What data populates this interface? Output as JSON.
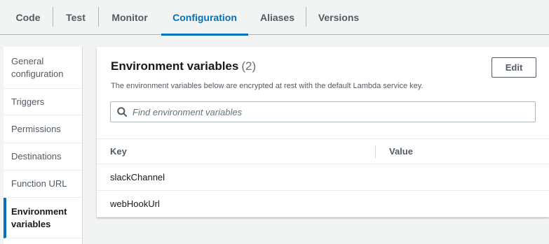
{
  "tabs": [
    {
      "label": "Code"
    },
    {
      "label": "Test"
    },
    {
      "label": "Monitor"
    },
    {
      "label": "Configuration",
      "active": true
    },
    {
      "label": "Aliases"
    },
    {
      "label": "Versions"
    }
  ],
  "sidebar": {
    "items": [
      {
        "label": "General configuration"
      },
      {
        "label": "Triggers"
      },
      {
        "label": "Permissions"
      },
      {
        "label": "Destinations"
      },
      {
        "label": "Function URL"
      },
      {
        "label": "Environment variables",
        "active": true
      }
    ]
  },
  "panel": {
    "title": "Environment variables",
    "count": "(2)",
    "description": "The environment variables below are encrypted at rest with the default Lambda service key.",
    "edit_label": "Edit",
    "search": {
      "placeholder": "Find environment variables",
      "value": ""
    },
    "table": {
      "columns": [
        "Key",
        "Value"
      ],
      "rows": [
        {
          "key": "slackChannel",
          "value": ""
        },
        {
          "key": "webHookUrl",
          "value": ""
        }
      ]
    }
  },
  "colors": {
    "accent": "#0073bb",
    "background": "#f2f3f3",
    "panel": "#ffffff",
    "text_muted": "#545b64"
  },
  "icons": {
    "search": "search-icon"
  }
}
